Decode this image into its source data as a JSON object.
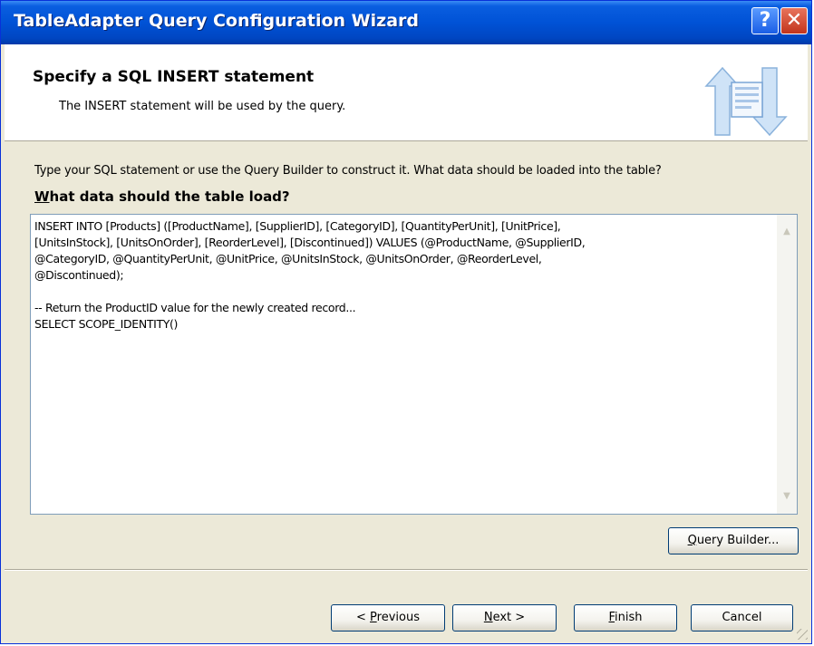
{
  "window": {
    "title": "TableAdapter Query Configuration Wizard",
    "help_glyph": "?",
    "close_glyph": "✕"
  },
  "header": {
    "title": "Specify a SQL INSERT statement",
    "subtitle": "The INSERT statement will be used by the query.",
    "icon": "wizard-sql-icon"
  },
  "main": {
    "instruction": "Type your SQL statement or use the Query Builder to construct it. What data should be loaded into the table?",
    "label_mnemonic": "W",
    "label_rest": "hat data should the table load?",
    "sql_text": "INSERT INTO [Products] ([ProductName], [SupplierID], [CategoryID], [QuantityPerUnit], [UnitPrice],\n[UnitsInStock], [UnitsOnOrder], [ReorderLevel], [Discontinued]) VALUES (@ProductName, @SupplierID,\n@CategoryID, @QuantityPerUnit, @UnitPrice, @UnitsInStock, @UnitsOnOrder, @ReorderLevel,\n@Discontinued);\n\n-- Return the ProductID value for the newly created record...\nSELECT SCOPE_IDENTITY()",
    "query_builder": {
      "mnemonic": "Q",
      "rest": "uery Builder..."
    }
  },
  "footer": {
    "previous": {
      "prefix": "< ",
      "mnemonic": "P",
      "rest": "revious"
    },
    "next": {
      "mnemonic": "N",
      "rest": "ext >"
    },
    "finish": {
      "mnemonic": "F",
      "rest": "inish"
    },
    "cancel": {
      "label": "Cancel"
    }
  },
  "colors": {
    "title_bar": "#0054e3",
    "dialog_bg": "#ece9d8",
    "close_button": "#d1492c"
  }
}
